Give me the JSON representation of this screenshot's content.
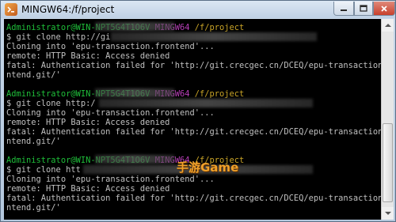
{
  "window": {
    "title": "MINGW64:/f/project"
  },
  "terminal": {
    "lines": [
      {
        "kind": "prompt",
        "user": "Administrator@WIN-NPT5G4T1O6V",
        "host": "MINGW64",
        "path": "/f/project"
      },
      {
        "kind": "text",
        "text": "$ git clone http://gi"
      },
      {
        "kind": "text",
        "text": "Cloning into 'epu-transaction.frontend'..."
      },
      {
        "kind": "text",
        "text": "remote: HTTP Basic: Access denied"
      },
      {
        "kind": "text",
        "text": "fatal: Authentication failed for 'http://git.crecgec.cn/DCEQ/epu-transaction.fro"
      },
      {
        "kind": "text",
        "text": "ntend.git/'"
      },
      {
        "kind": "blank",
        "text": ""
      },
      {
        "kind": "prompt",
        "user": "Administrator@WIN-NPT5G4T1O6V",
        "host": "MINGW64",
        "path": "/f/project"
      },
      {
        "kind": "text",
        "text": "$ git clone http:/"
      },
      {
        "kind": "text",
        "text": "Cloning into 'epu-transaction.frontend'..."
      },
      {
        "kind": "text",
        "text": "remote: HTTP Basic: Access denied"
      },
      {
        "kind": "text",
        "text": "fatal: Authentication failed for 'http://git.crecgec.cn/DCEQ/epu-transaction.fro"
      },
      {
        "kind": "text",
        "text": "ntend.git/'"
      },
      {
        "kind": "blank",
        "text": ""
      },
      {
        "kind": "prompt",
        "user": "Administrator@WIN-NPT5G4T1O6V",
        "host": "MINGW64",
        "path": "/f/project"
      },
      {
        "kind": "text",
        "text": "$ git clone htt"
      },
      {
        "kind": "text",
        "text": "Cloning into 'epu-transaction.frontend'..."
      },
      {
        "kind": "text",
        "text": "remote: HTTP Basic: Access denied"
      },
      {
        "kind": "text",
        "text": "fatal: Authentication failed for 'http://git.crecgec.cn/DCEQ/epu-transaction.fro"
      },
      {
        "kind": "text",
        "text": "ntend.git/'"
      }
    ]
  },
  "watermark": {
    "text": "手游Game"
  },
  "colors": {
    "prompt_user": "#1fbf3a",
    "prompt_host": "#b93fb9",
    "prompt_path": "#c9a427",
    "terminal_text": "#c0c0c0",
    "watermark": "#f0a12a"
  },
  "icons": {
    "app": "git-bash-icon",
    "minimize": "minimize-icon",
    "maximize": "maximize-icon",
    "close": "close-icon",
    "scroll_up": "arrow-up-icon",
    "scroll_down": "arrow-down-icon"
  }
}
